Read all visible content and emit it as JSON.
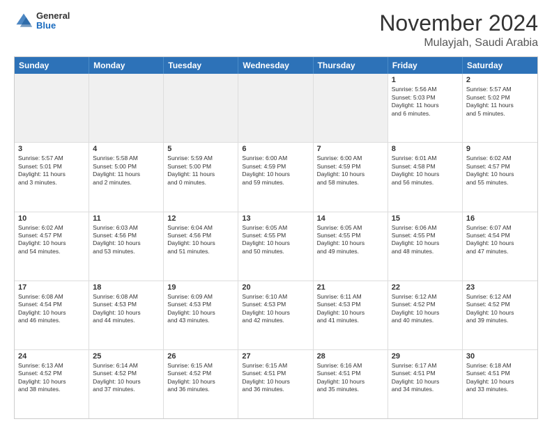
{
  "header": {
    "logo": {
      "line1": "General",
      "line2": "Blue"
    },
    "title": "November 2024",
    "location": "Mulayjah, Saudi Arabia"
  },
  "weekdays": [
    "Sunday",
    "Monday",
    "Tuesday",
    "Wednesday",
    "Thursday",
    "Friday",
    "Saturday"
  ],
  "rows": [
    [
      {
        "day": "",
        "text": ""
      },
      {
        "day": "",
        "text": ""
      },
      {
        "day": "",
        "text": ""
      },
      {
        "day": "",
        "text": ""
      },
      {
        "day": "",
        "text": ""
      },
      {
        "day": "1",
        "text": "Sunrise: 5:56 AM\nSunset: 5:03 PM\nDaylight: 11 hours\nand 6 minutes."
      },
      {
        "day": "2",
        "text": "Sunrise: 5:57 AM\nSunset: 5:02 PM\nDaylight: 11 hours\nand 5 minutes."
      }
    ],
    [
      {
        "day": "3",
        "text": "Sunrise: 5:57 AM\nSunset: 5:01 PM\nDaylight: 11 hours\nand 3 minutes."
      },
      {
        "day": "4",
        "text": "Sunrise: 5:58 AM\nSunset: 5:00 PM\nDaylight: 11 hours\nand 2 minutes."
      },
      {
        "day": "5",
        "text": "Sunrise: 5:59 AM\nSunset: 5:00 PM\nDaylight: 11 hours\nand 0 minutes."
      },
      {
        "day": "6",
        "text": "Sunrise: 6:00 AM\nSunset: 4:59 PM\nDaylight: 10 hours\nand 59 minutes."
      },
      {
        "day": "7",
        "text": "Sunrise: 6:00 AM\nSunset: 4:59 PM\nDaylight: 10 hours\nand 58 minutes."
      },
      {
        "day": "8",
        "text": "Sunrise: 6:01 AM\nSunset: 4:58 PM\nDaylight: 10 hours\nand 56 minutes."
      },
      {
        "day": "9",
        "text": "Sunrise: 6:02 AM\nSunset: 4:57 PM\nDaylight: 10 hours\nand 55 minutes."
      }
    ],
    [
      {
        "day": "10",
        "text": "Sunrise: 6:02 AM\nSunset: 4:57 PM\nDaylight: 10 hours\nand 54 minutes."
      },
      {
        "day": "11",
        "text": "Sunrise: 6:03 AM\nSunset: 4:56 PM\nDaylight: 10 hours\nand 53 minutes."
      },
      {
        "day": "12",
        "text": "Sunrise: 6:04 AM\nSunset: 4:56 PM\nDaylight: 10 hours\nand 51 minutes."
      },
      {
        "day": "13",
        "text": "Sunrise: 6:05 AM\nSunset: 4:55 PM\nDaylight: 10 hours\nand 50 minutes."
      },
      {
        "day": "14",
        "text": "Sunrise: 6:05 AM\nSunset: 4:55 PM\nDaylight: 10 hours\nand 49 minutes."
      },
      {
        "day": "15",
        "text": "Sunrise: 6:06 AM\nSunset: 4:55 PM\nDaylight: 10 hours\nand 48 minutes."
      },
      {
        "day": "16",
        "text": "Sunrise: 6:07 AM\nSunset: 4:54 PM\nDaylight: 10 hours\nand 47 minutes."
      }
    ],
    [
      {
        "day": "17",
        "text": "Sunrise: 6:08 AM\nSunset: 4:54 PM\nDaylight: 10 hours\nand 46 minutes."
      },
      {
        "day": "18",
        "text": "Sunrise: 6:08 AM\nSunset: 4:53 PM\nDaylight: 10 hours\nand 44 minutes."
      },
      {
        "day": "19",
        "text": "Sunrise: 6:09 AM\nSunset: 4:53 PM\nDaylight: 10 hours\nand 43 minutes."
      },
      {
        "day": "20",
        "text": "Sunrise: 6:10 AM\nSunset: 4:53 PM\nDaylight: 10 hours\nand 42 minutes."
      },
      {
        "day": "21",
        "text": "Sunrise: 6:11 AM\nSunset: 4:53 PM\nDaylight: 10 hours\nand 41 minutes."
      },
      {
        "day": "22",
        "text": "Sunrise: 6:12 AM\nSunset: 4:52 PM\nDaylight: 10 hours\nand 40 minutes."
      },
      {
        "day": "23",
        "text": "Sunrise: 6:12 AM\nSunset: 4:52 PM\nDaylight: 10 hours\nand 39 minutes."
      }
    ],
    [
      {
        "day": "24",
        "text": "Sunrise: 6:13 AM\nSunset: 4:52 PM\nDaylight: 10 hours\nand 38 minutes."
      },
      {
        "day": "25",
        "text": "Sunrise: 6:14 AM\nSunset: 4:52 PM\nDaylight: 10 hours\nand 37 minutes."
      },
      {
        "day": "26",
        "text": "Sunrise: 6:15 AM\nSunset: 4:52 PM\nDaylight: 10 hours\nand 36 minutes."
      },
      {
        "day": "27",
        "text": "Sunrise: 6:15 AM\nSunset: 4:51 PM\nDaylight: 10 hours\nand 36 minutes."
      },
      {
        "day": "28",
        "text": "Sunrise: 6:16 AM\nSunset: 4:51 PM\nDaylight: 10 hours\nand 35 minutes."
      },
      {
        "day": "29",
        "text": "Sunrise: 6:17 AM\nSunset: 4:51 PM\nDaylight: 10 hours\nand 34 minutes."
      },
      {
        "day": "30",
        "text": "Sunrise: 6:18 AM\nSunset: 4:51 PM\nDaylight: 10 hours\nand 33 minutes."
      }
    ]
  ]
}
